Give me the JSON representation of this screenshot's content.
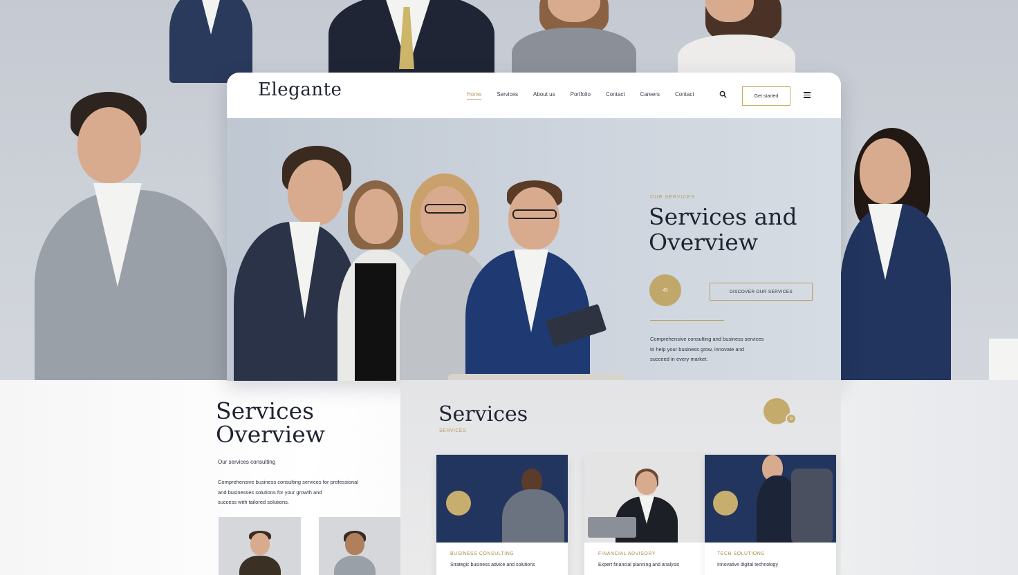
{
  "brand": {
    "logo": "Elegante",
    "accent": "#b79d5e",
    "navy": "#22355e"
  },
  "nav": {
    "links": [
      "Home",
      "Services",
      "About us",
      "Portfolio",
      "Contact",
      "Careers",
      "Contact"
    ],
    "cta": "Get started",
    "search_icon": "search-icon",
    "menu_icon": "hamburger-menu-icon"
  },
  "hero": {
    "eyebrow": "OUR SERVICES",
    "title": "Services and Overview",
    "badge": "45",
    "button": "DISCOVER OUR SERVICES",
    "body_lines": [
      "Comprehensive consulting and business services",
      "to help your business grow, innovate and",
      "succeed in every market."
    ]
  },
  "overview": {
    "title": "Services Overview",
    "subtitle": "Our services consulting",
    "body_lines": [
      "Comprehensive business consulting services for professional",
      "and businesses solutions for your growth and",
      "success with tailored solutions."
    ]
  },
  "services": {
    "title": "Services",
    "subtitle": "SERVICES",
    "deco_badge": "0",
    "cards": [
      {
        "title": "BUSINESS CONSULTING",
        "desc": "Strategic business advice and solutions"
      },
      {
        "title": "FINANCIAL ADVISORY",
        "desc": "Expert financial planning and analysis"
      },
      {
        "title": "TECH SOLUTIONS",
        "desc": "Innovative digital technology"
      }
    ]
  }
}
